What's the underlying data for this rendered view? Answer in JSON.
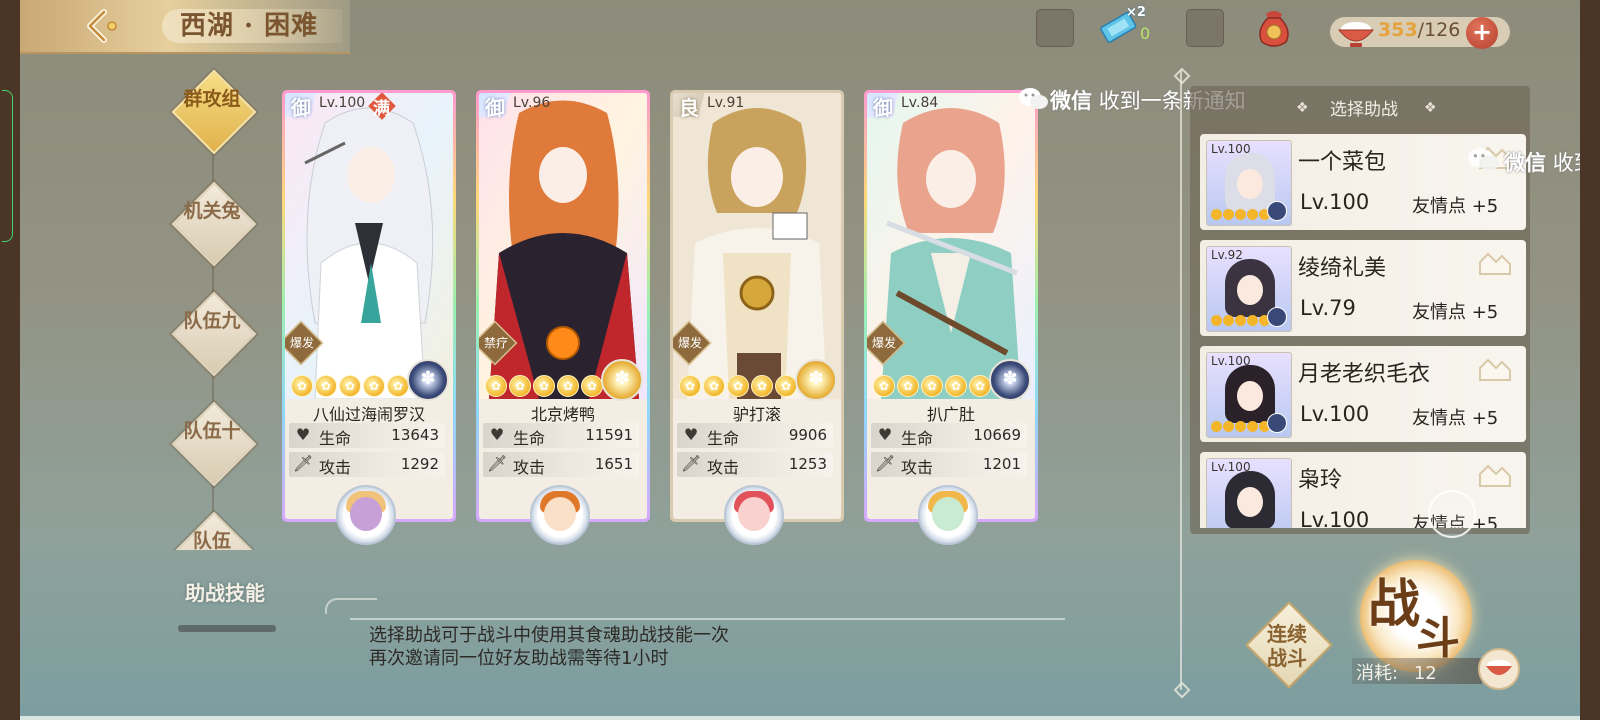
{
  "header": {
    "stage_title": "西湖 · 困难",
    "ticket_multiplier": "×2",
    "ticket_count": "0",
    "stamina_current": "353",
    "stamina_separator": "/",
    "stamina_max": "126",
    "plus_label": "+"
  },
  "nav": {
    "items": [
      {
        "label": "群攻组",
        "active": true
      },
      {
        "label": "机关兔",
        "active": false
      },
      {
        "label": "队伍九",
        "active": false
      },
      {
        "label": "队伍十",
        "active": false
      },
      {
        "label": "队伍",
        "active": false
      }
    ],
    "assist_title": "助战技能"
  },
  "cards": [
    {
      "grade": "御",
      "level": "Lv.100",
      "max_badge": "满",
      "type": "爆发",
      "name": "八仙过海闹罗汉",
      "hp_label": "生命",
      "hp": "13643",
      "atk_label": "攻击",
      "atk": "1292",
      "stars": 5,
      "orb_color": "blue"
    },
    {
      "grade": "御",
      "level": "Lv.96",
      "max_badge": "",
      "type": "禁疗",
      "name": "北京烤鸭",
      "hp_label": "生命",
      "hp": "11591",
      "atk_label": "攻击",
      "atk": "1651",
      "stars": 5,
      "orb_color": "gold"
    },
    {
      "grade": "良",
      "level": "Lv.91",
      "max_badge": "",
      "type": "爆发",
      "name": "驴打滚",
      "hp_label": "生命",
      "hp": "9906",
      "atk_label": "攻击",
      "atk": "1253",
      "stars": 5,
      "orb_color": "gold"
    },
    {
      "grade": "御",
      "level": "Lv.84",
      "max_badge": "",
      "type": "爆发",
      "name": "扒广肚",
      "hp_label": "生命",
      "hp": "10669",
      "atk_label": "攻击",
      "atk": "1201",
      "stars": 5,
      "orb_color": "blue"
    }
  ],
  "assist_desc": {
    "line1": "选择助战可于战斗中使用其食魂助战技能一次",
    "line2": "再次邀请同一位好友助战需等待1小时"
  },
  "notification": {
    "app": "微信",
    "message": "收到一条新通知",
    "app_2": "微信",
    "message_2": "收到"
  },
  "helpers": {
    "title": "选择助战",
    "items": [
      {
        "avatar_level": "Lv.100",
        "name": "一个菜包",
        "level": "Lv.100",
        "bond": "友情点 +5"
      },
      {
        "avatar_level": "Lv.92",
        "name": "绫绮礼美",
        "level": "Lv.79",
        "bond": "友情点 +5"
      },
      {
        "avatar_level": "Lv.100",
        "name": "月老老织毛衣",
        "level": "Lv.100",
        "bond": "友情点 +5"
      },
      {
        "avatar_level": "Lv.100",
        "name": "枭玲",
        "level": "Lv.100",
        "bond": "友情点 +5"
      }
    ]
  },
  "battle": {
    "auto_label": "连续战斗",
    "fight_char1": "战",
    "fight_char2": "斗",
    "cost_label": "消耗:",
    "cost_value": "12"
  }
}
